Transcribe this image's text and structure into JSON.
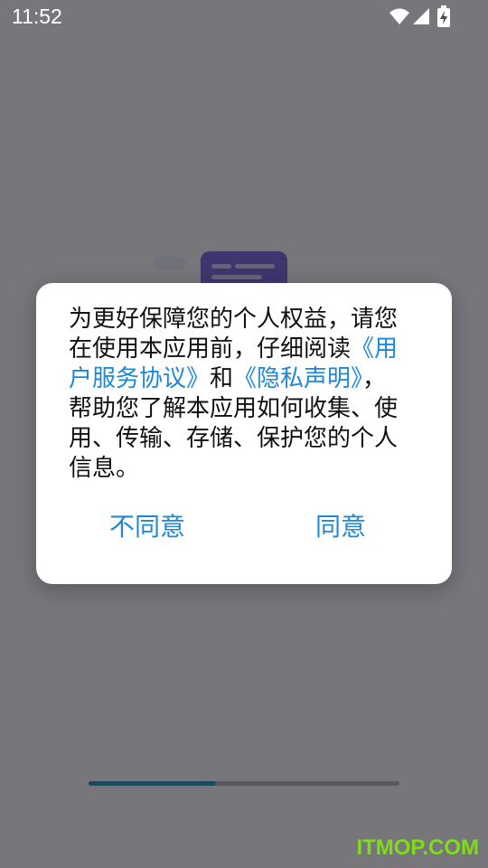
{
  "status_bar": {
    "time": "11:52",
    "icons": [
      "wifi-icon",
      "signal-icon",
      "battery-charging-icon"
    ]
  },
  "dialog": {
    "text_1": "为更好保障您的个人权益，请您在使用本应用前，仔细阅读",
    "link_user_agreement": "《用户服务协议》",
    "text_and": "和",
    "link_privacy": "《隐私声明》",
    "text_2": "，帮助您了解本应用如何收集、使用、传输、存储、保护您的个人信息。",
    "disagree_label": "不同意",
    "agree_label": "同意"
  },
  "loading": {
    "progress_fraction": 0.41
  },
  "watermark": "ITMOP.COM",
  "colors": {
    "link": "#1e88d8",
    "progress": "#0c7fb0",
    "watermark": "#7fdc1a"
  }
}
